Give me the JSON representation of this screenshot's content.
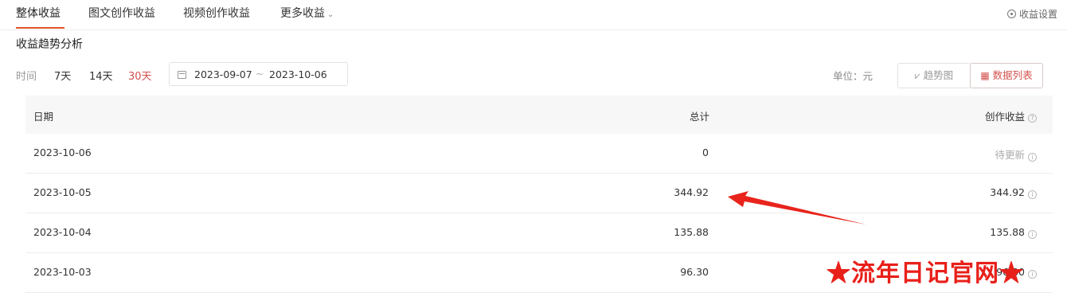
{
  "tabs": {
    "overall": "整体收益",
    "article": "图文创作收益",
    "video": "视频创作收益",
    "more": "更多收益",
    "more_chevron": "⌄"
  },
  "settings": {
    "label": "收益设置",
    "icon": "settings-circle-icon"
  },
  "section": {
    "title": "收益趋势分析"
  },
  "filter": {
    "label": "时间",
    "ranges": [
      "7天",
      "14天",
      "30天"
    ],
    "active_range": "30天",
    "date_start": "2023-09-07",
    "date_sep": "~",
    "date_end": "2023-10-06",
    "unit": "单位：元",
    "trend_button": "趋势图",
    "list_button": "数据列表",
    "active_view": "数据列表"
  },
  "table": {
    "headers": {
      "date": "日期",
      "total": "总计",
      "creation": "创作收益"
    },
    "rows": [
      {
        "date": "2023-10-06",
        "total": "0",
        "creation": "待更新"
      },
      {
        "date": "2023-10-05",
        "total": "344.92",
        "creation": "344.92"
      },
      {
        "date": "2023-10-04",
        "total": "135.88",
        "creation": "135.88"
      },
      {
        "date": "2023-10-03",
        "total": "96.30",
        "creation": "96.30"
      }
    ]
  },
  "watermark": {
    "text": "★流年日记官网★"
  },
  "colors": {
    "accent": "#e2532a",
    "active_red": "#d2514d",
    "arrow": "#e8241c",
    "watermark": "#e8201a"
  }
}
